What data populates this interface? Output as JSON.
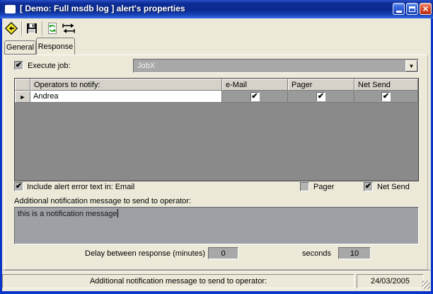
{
  "glyphs": {
    "check": "✔",
    "row_arrow": "►",
    "dropdown_arrow": "▼",
    "close": "×"
  },
  "window": {
    "title": "[ Demo: Full msdb log ] alert's properties"
  },
  "toolbar": {
    "icons": [
      {
        "name": "alert-diamond-icon"
      },
      {
        "name": "save-icon"
      },
      {
        "name": "refresh-script-icon"
      },
      {
        "name": "swap-arrows-icon"
      }
    ]
  },
  "tabs": {
    "general": "General",
    "response": "Response",
    "active": "Response"
  },
  "execute_job": {
    "label": "Execute job:",
    "checked": true,
    "value": "JobX"
  },
  "grid": {
    "columns": {
      "operators": "Operators to notify:",
      "email": "e-Mail",
      "pager": "Pager",
      "net_send": "Net Send"
    },
    "rows": [
      {
        "operator": "Andrea",
        "email": true,
        "pager": true,
        "net_send": true
      }
    ]
  },
  "alert_text_options": {
    "email": {
      "label": "Include alert error text in: Email",
      "checked": true
    },
    "pager": {
      "label": "Pager",
      "checked": false
    },
    "net_send": {
      "label": "Net Send",
      "checked": true
    }
  },
  "notification": {
    "label": "Additional notification message to send to operator:",
    "message": "this is a notification message"
  },
  "delay": {
    "minutes_label": "Delay between response (minutes)",
    "minutes_value": "0",
    "seconds_label": "seconds",
    "seconds_value": "10"
  },
  "status_bar": {
    "message": "Additional notification message to send to operator:",
    "date": "24/03/2005"
  },
  "colors": {
    "titlebar_top": "#0c2c96",
    "titlebar_bottom": "#3a70ea",
    "window_border": "#0a35c8",
    "client_bg": "#ece9d8",
    "grid_header": "#d6d2ca",
    "grid_cell_gray": "#9a9a9a",
    "grid_filler": "#8a8a8a",
    "field_gray": "#a8a8a8",
    "textarea_gray": "#9da0a5",
    "close_button": "#cc3a1c",
    "refresh_green": "#1a9c1a",
    "diamond_yellow": "#f2e32a"
  }
}
